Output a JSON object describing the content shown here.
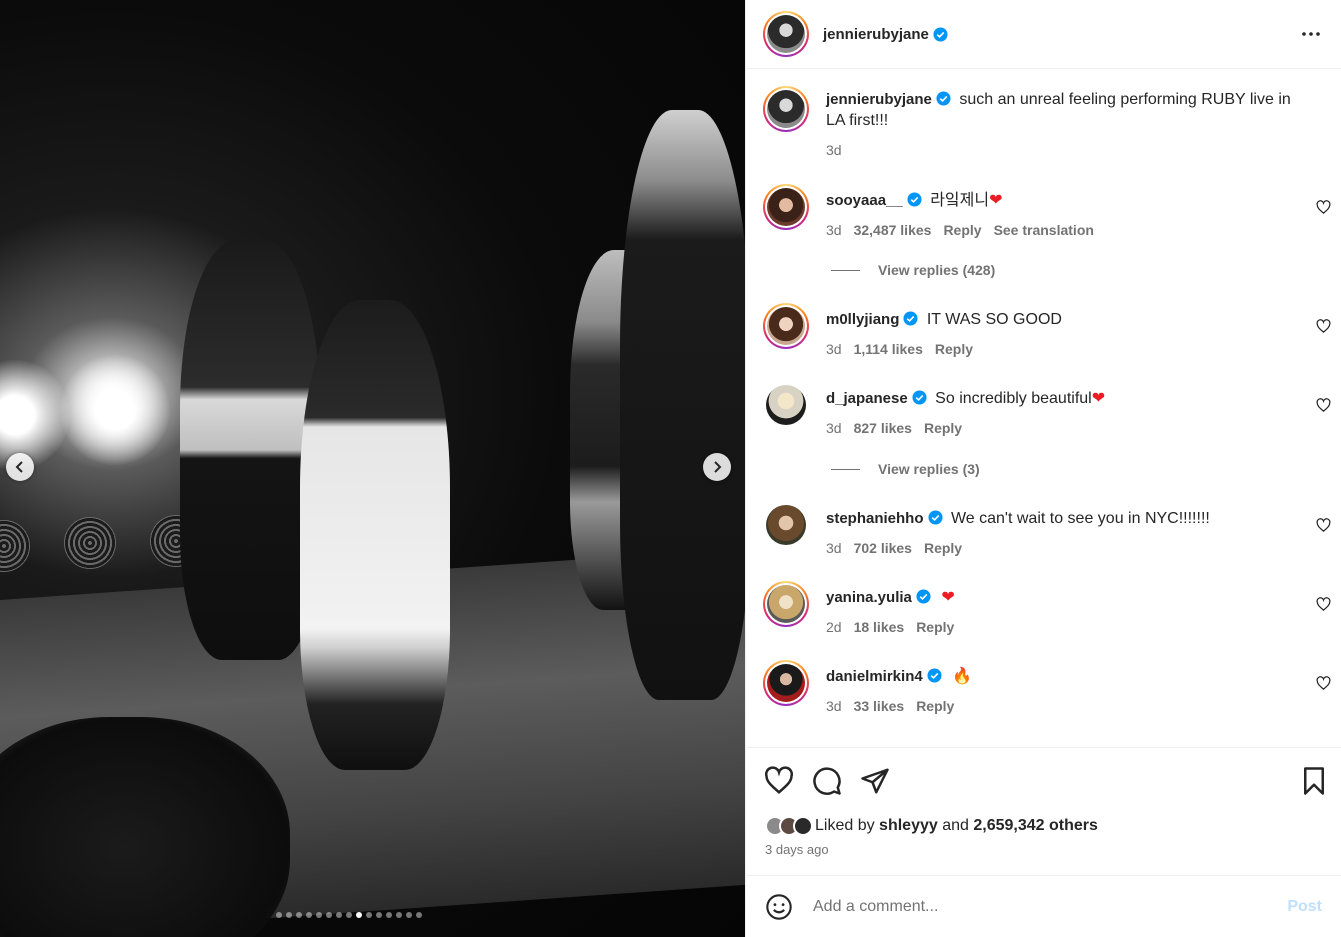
{
  "post": {
    "author": "jennierubyjane",
    "caption": "such an unreal feeling performing RUBY live in LA first!!!",
    "caption_age": "3d",
    "carousel": {
      "count": 15,
      "active_index": 8
    }
  },
  "comments": [
    {
      "user": "sooyaaa__",
      "text": "라잌제니",
      "emoji": "❤",
      "age": "3d",
      "likes": "32,487 likes",
      "reply": "Reply",
      "translate": "See translation",
      "view_replies": "View replies (428)"
    },
    {
      "user": "m0llyjiang",
      "text": "IT WAS SO GOOD",
      "emoji": "",
      "age": "3d",
      "likes": "1,114 likes",
      "reply": "Reply"
    },
    {
      "user": "d_japanese",
      "text": "So incredibly beautiful",
      "emoji": "❤",
      "age": "3d",
      "likes": "827 likes",
      "reply": "Reply",
      "view_replies": "View replies (3)"
    },
    {
      "user": "stephaniehho",
      "text": "We can't wait to see you in NYC!!!!!!!",
      "emoji": "",
      "age": "3d",
      "likes": "702 likes",
      "reply": "Reply"
    },
    {
      "user": "yanina.yulia",
      "text": "",
      "emoji": "❤",
      "age": "2d",
      "likes": "18 likes",
      "reply": "Reply"
    },
    {
      "user": "danielmirkin4",
      "text": "",
      "emoji": "🔥",
      "age": "3d",
      "likes": "33 likes",
      "reply": "Reply"
    }
  ],
  "likes": {
    "prefix": "Liked by",
    "user": "shleyyy",
    "and": "and",
    "others": "2,659,342 others"
  },
  "post_age": "3 days ago",
  "composer": {
    "placeholder": "Add a comment...",
    "post_label": "Post"
  },
  "colors": {
    "verified": "#0095f6",
    "heart_red": "#ed1c24",
    "post_disabled": "#c0dffd",
    "muted": "#737373"
  }
}
